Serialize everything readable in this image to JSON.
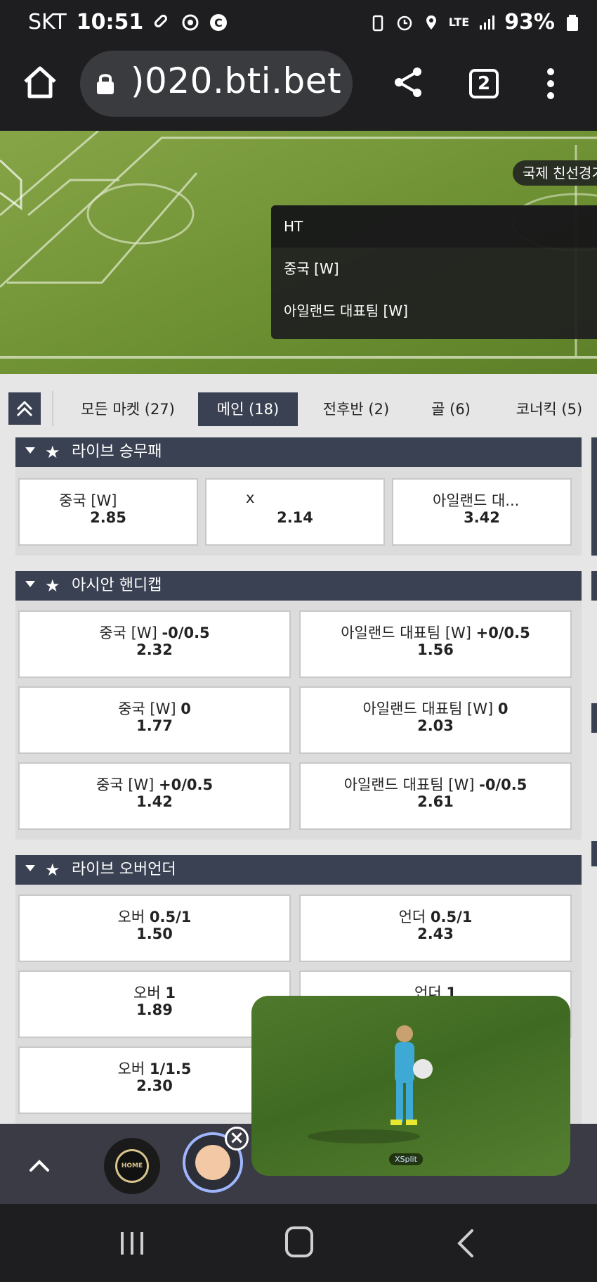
{
  "status_bar": {
    "carrier": "SKT",
    "time": "10:51",
    "battery": "93%",
    "network": "LTE"
  },
  "browser": {
    "url": ")020.bti.bet",
    "tab_count": "2"
  },
  "hero": {
    "competition_tag": "국제 친선경기",
    "score_rows": [
      "HT",
      "중국 [W]",
      "아일랜드 대표팀 [W]"
    ]
  },
  "tabs": [
    {
      "label": "모든 마켓 (27)",
      "active": false
    },
    {
      "label": "메인 (18)",
      "active": true
    },
    {
      "label": "전후반 (2)",
      "active": false
    },
    {
      "label": "골 (6)",
      "active": false
    },
    {
      "label": "코너킥 (5)",
      "active": false
    }
  ],
  "sections": {
    "match_result": {
      "title": "라이브 승무패",
      "odds": [
        {
          "label": "중국 [W]",
          "value": "2.85"
        },
        {
          "label": "x",
          "value": "2.14"
        },
        {
          "label": "아일랜드 대...",
          "value": "3.42"
        }
      ]
    },
    "asian_handicap": {
      "title": "아시안 핸디캡",
      "odds": [
        {
          "team": "중국 [W]",
          "line": "-0/0.5",
          "value": "2.32"
        },
        {
          "team": "아일랜드 대표팀 [W]",
          "line": "+0/0.5",
          "value": "1.56"
        },
        {
          "team": "중국 [W]",
          "line": "0",
          "value": "1.77"
        },
        {
          "team": "아일랜드 대표팀 [W]",
          "line": "0",
          "value": "2.03"
        },
        {
          "team": "중국 [W]",
          "line": "+0/0.5",
          "value": "1.42"
        },
        {
          "team": "아일랜드 대표팀 [W]",
          "line": "-0/0.5",
          "value": "2.61"
        }
      ]
    },
    "over_under": {
      "title": "라이브 오버언더",
      "odds": [
        {
          "team": "오버",
          "line": "0.5/1",
          "value": "1.50"
        },
        {
          "team": "언더",
          "line": "0.5/1",
          "value": "2.43"
        },
        {
          "team": "오버",
          "line": "1",
          "value": "1.89"
        },
        {
          "team": "언더",
          "line": "1",
          "value": ""
        },
        {
          "team": "오버",
          "line": "1/1.5",
          "value": "2.30"
        }
      ]
    }
  },
  "pip": {
    "watermark": "XSplit"
  },
  "bubbles": {
    "home_label": "HOME"
  },
  "colors": {
    "header_dark": "#1e1e20",
    "section_head": "#3a4152",
    "pitch_green": "#6f9033"
  }
}
